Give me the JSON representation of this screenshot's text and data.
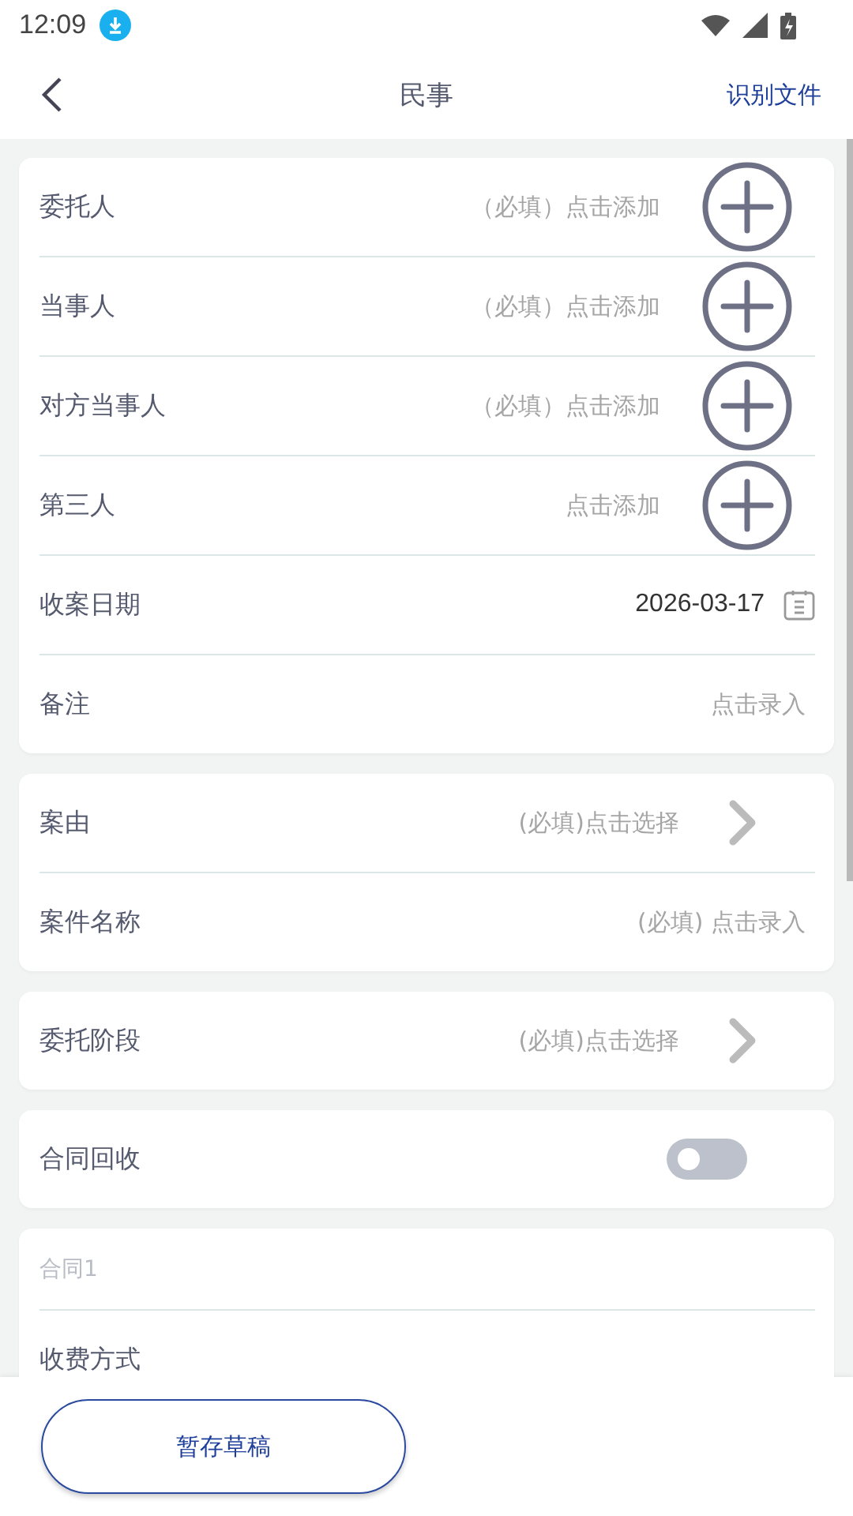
{
  "status_bar": {
    "time": "12:09"
  },
  "header": {
    "title": "民事",
    "action": "识别文件"
  },
  "cards": [
    {
      "rows": [
        {
          "kind": "add",
          "label": "委托人",
          "hint": "（必填）点击添加"
        },
        {
          "kind": "add",
          "label": "当事人",
          "hint": "（必填）点击添加"
        },
        {
          "kind": "add",
          "label": "对方当事人",
          "hint": "（必填）点击添加"
        },
        {
          "kind": "add",
          "label": "第三人",
          "hint": "点击添加"
        },
        {
          "kind": "date",
          "label": "收案日期",
          "value": "2026-03-17"
        },
        {
          "kind": "input",
          "label": "备注",
          "hint": "点击录入"
        }
      ]
    },
    {
      "rows": [
        {
          "kind": "select",
          "label": "案由",
          "hint": "(必填)点击选择"
        },
        {
          "kind": "input",
          "label": "案件名称",
          "hint": "(必填) 点击录入"
        }
      ]
    },
    {
      "rows": [
        {
          "kind": "select",
          "label": "委托阶段",
          "hint": "(必填)点击选择"
        }
      ]
    },
    {
      "rows": [
        {
          "kind": "switch",
          "label": "合同回收",
          "on": false
        }
      ]
    },
    {
      "rows": [
        {
          "kind": "heading",
          "label": "合同1"
        },
        {
          "kind": "plain",
          "label": "收费方式"
        }
      ]
    }
  ],
  "footer": {
    "draft_button": "暂存草稿"
  }
}
